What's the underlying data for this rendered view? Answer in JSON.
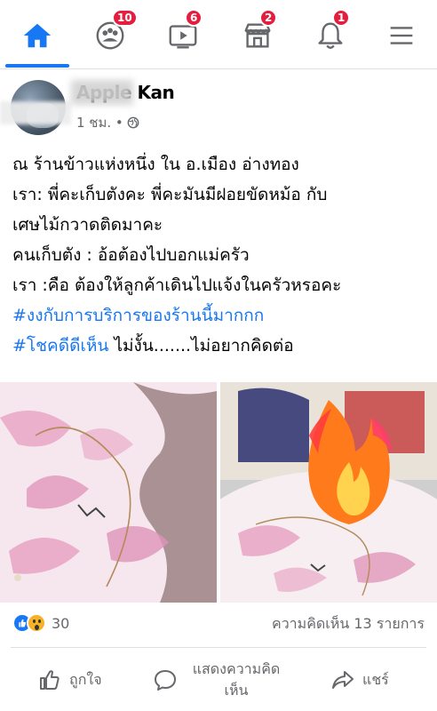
{
  "nav": {
    "items": [
      {
        "name": "home",
        "badge": ""
      },
      {
        "name": "groups",
        "badge": "10"
      },
      {
        "name": "watch",
        "badge": "6"
      },
      {
        "name": "marketplace",
        "badge": "2"
      },
      {
        "name": "notifications",
        "badge": "1"
      },
      {
        "name": "menu",
        "badge": ""
      }
    ],
    "accent": "#1877f2",
    "badge_color": "#e41e3f"
  },
  "post": {
    "author": "Apple Kan",
    "time": "1 ชม. •",
    "privacy_icon": "globe-icon",
    "lines": [
      {
        "text": "ณ ร้านข้าวแห่งหนึ่ง ใน อ.เมือง อ่างทอง"
      },
      {
        "text": "เรา:   พี่คะเก็บตังคะ พี่คะมันมีฝอยขัดหม้อ กับ"
      },
      {
        "text": "เศษไม้กวาดติดมาคะ"
      },
      {
        "text": "คนเก็บตัง : อ้อต้องไปบอกแม่ครัว"
      },
      {
        "text": "เรา :คือ ต้องให้ลูกค้าเดินไปแจ้งในครัวหรอคะ"
      }
    ],
    "hashtag1": "#งงกับการบริการของร้านนี้มากกก",
    "hashtag2": "#โชคดีดีเห็น",
    "tail_text": " ไม่งั้น.......ไม่อยากคิดต่อ"
  },
  "stats": {
    "reaction_count": "30",
    "comments": "ความคิดเห็น 13 รายการ"
  },
  "actions": {
    "like": "ถูกใจ",
    "comment_line1": "แสดงความคิด",
    "comment_line2": "เห็น",
    "share": "แชร์"
  }
}
